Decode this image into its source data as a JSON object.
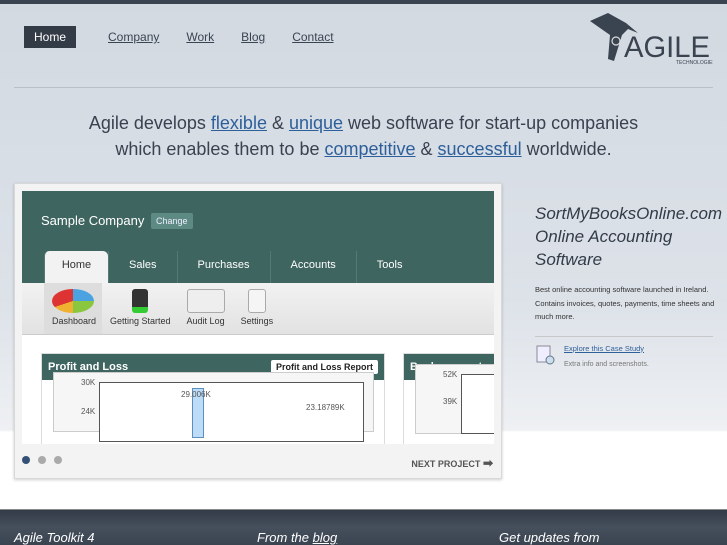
{
  "nav": {
    "items": [
      "Home",
      "Company",
      "Work",
      "Blog",
      "Contact"
    ]
  },
  "logo": {
    "text": "AGILE",
    "sub": "TECHNOLOGIES"
  },
  "tagline": {
    "p1": "Agile develops ",
    "l1": "flexible",
    "p2": " & ",
    "l2": "unique",
    "p3": " web software for start-up companies",
    "p4": "which enables them to be ",
    "l3": "competitive",
    "p5": " & ",
    "l4": "successful",
    "p6": " worldwide."
  },
  "shot": {
    "company": "Sample Company",
    "change": "Change",
    "tabs": [
      "Home",
      "Sales",
      "Purchases",
      "Accounts",
      "Tools"
    ],
    "sub": [
      "Dashboard",
      "Getting Started",
      "Audit Log",
      "Settings"
    ],
    "pl_title": "Profit and Loss",
    "pl_button": "Profit and Loss Report",
    "pl_ticks": [
      "30K",
      "24K"
    ],
    "pl_labels": [
      "29.006K",
      "23.18789K"
    ],
    "bank_title": "Bank accounts",
    "bank_ticks": [
      "52K",
      "39K"
    ]
  },
  "slider": {
    "next": "NEXT PROJECT"
  },
  "project": {
    "title": "SortMyBooksOnline.com - Online Accounting Software",
    "desc": "Best online accounting software launched in Ireland. Contains invoices, quotes, payments, time sheets and much more.",
    "link": "Explore this Case Study",
    "link_sub": "Extra info and screenshots."
  },
  "footer": {
    "c1": "Agile Toolkit 4",
    "c2": "From the ",
    "c2link": "blog",
    "c3": "Get updates from"
  }
}
